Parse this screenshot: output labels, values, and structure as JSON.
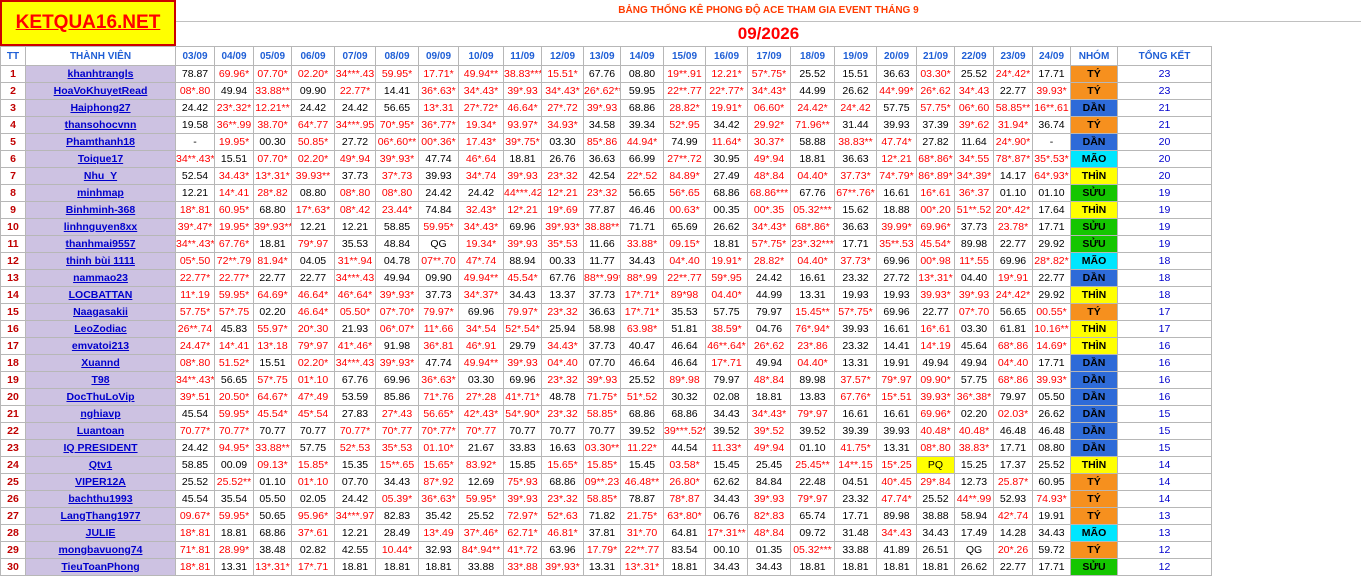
{
  "header": {
    "logo": "KETQUA16.NET",
    "title": "BẢNG THỐNG KÊ PHONG ĐỘ ACE THAM GIA EVENT THÁNG 9",
    "month": "09/2026"
  },
  "columns": {
    "tt": "TT",
    "member": "THÀNH VIÊN",
    "dates": [
      "03/09",
      "04/09",
      "05/09",
      "06/09",
      "07/09",
      "08/09",
      "09/09",
      "10/09",
      "11/09",
      "12/09",
      "13/09",
      "14/09",
      "15/09",
      "16/09",
      "17/09",
      "18/09",
      "19/09",
      "20/09",
      "21/09",
      "22/09",
      "23/09",
      "24/09"
    ],
    "group": "NHÓM",
    "total": "TỔNG KẾT"
  },
  "colors": {
    "TÝ": "#f6901e",
    "DẦN": "#2e6bd8",
    "MÃO": "#00e6ff",
    "THÌN": "#ffff00",
    "SỬU": "#14c600"
  },
  "rows": [
    {
      "tt": "1",
      "name": "khanhtrangls",
      "vals": [
        "78.87",
        "69.96*",
        "07.70*",
        "02.20*",
        "34***.43",
        "59.95*",
        "17.71*",
        "49.94**",
        "38.83***",
        "15.51*",
        "67.76",
        "08.80",
        "19**.91",
        "12.21*",
        "57*.75*",
        "25.52",
        "15.51",
        "36.63",
        "03.30*",
        "25.52",
        "24*.42*",
        "17.71"
      ],
      "group": "TÝ",
      "total": "23"
    },
    {
      "tt": "2",
      "name": "HoaVoKhuyetRead",
      "vals": [
        "08*.80",
        "49.94",
        "33.88**",
        "09.90",
        "22.77*",
        "14.41",
        "36*.63*",
        "34*.43*",
        "39*.93",
        "34*.43*",
        "26*.62**",
        "59.95",
        "22**.77",
        "22*.77*",
        "34*.43*",
        "44.99",
        "26.62",
        "44*.99*",
        "26*.62",
        "34*.43",
        "22.77",
        "39.93*"
      ],
      "group": "TÝ",
      "total": "23"
    },
    {
      "tt": "3",
      "name": "Haiphong27",
      "vals": [
        "24.42",
        "23*.32*",
        "12.21**",
        "24.42",
        "24.42",
        "56.65",
        "13*.31",
        "27*.72*",
        "46.64*",
        "27*.72",
        "39*.93",
        "68.86",
        "28.82*",
        "19.91*",
        "06.60*",
        "24.42*",
        "24*.42",
        "57.75",
        "57.75*",
        "06*.60",
        "58.85**",
        "16**.61"
      ],
      "group": "DẦN",
      "total": "21"
    },
    {
      "tt": "4",
      "name": "thansohocvnn",
      "vals": [
        "19.58",
        "36**.99",
        "38.70*",
        "64*.77",
        "34***.95",
        "70*.95*",
        "36*.77*",
        "19.34*",
        "93.97*",
        "34.93*",
        "34.58",
        "39.34",
        "52*.95",
        "34.42",
        "29.92*",
        "71.96**",
        "31.44",
        "39.93",
        "37.39",
        "39*.62",
        "31.94*",
        "36.74"
      ],
      "group": "TÝ",
      "total": "21"
    },
    {
      "tt": "5",
      "name": "Phamthanh18",
      "vals": [
        "-",
        "19.95*",
        "00.30",
        "50.85*",
        "27.72",
        "06*.60**",
        "00*.36*",
        "17.43*",
        "39*.75*",
        "03.30",
        "85*.86",
        "44.94*",
        "74.99",
        "11.64*",
        "30.37*",
        "58.88",
        "38.83**",
        "47.74*",
        "27.82",
        "11.64",
        "24*.90*",
        "-"
      ],
      "group": "DẦN",
      "total": "20"
    },
    {
      "tt": "6",
      "name": "Toique17",
      "vals": [
        "34**.43*",
        "15.51",
        "07.70*",
        "02.20*",
        "49*.94",
        "39*.93*",
        "47.74",
        "46*.64",
        "18.81",
        "26.76",
        "36.63",
        "66.99",
        "27**.72",
        "30.95",
        "49*.94",
        "18.81",
        "36.63",
        "12*.21",
        "68*.86*",
        "34*.55",
        "78*.87*",
        "35*.53*"
      ],
      "group": "MÃO",
      "total": "20"
    },
    {
      "tt": "7",
      "name": "Nhu_Y",
      "vals": [
        "52.54",
        "34.43*",
        "13*.31*",
        "39.93**",
        "37.73",
        "37*.73",
        "39.93",
        "34*.74",
        "39*.93",
        "23*.32",
        "42.54",
        "22*.52",
        "84.89*",
        "27.49",
        "48*.84",
        "04.40*",
        "37.73*",
        "74*.79*",
        "86*.89*",
        "34*.39*",
        "14.17",
        "64*.93*"
      ],
      "group": "THÌN",
      "total": "20"
    },
    {
      "tt": "8",
      "name": "minhmap",
      "vals": [
        "12.21",
        "14*.41",
        "28*.82",
        "08.80",
        "08*.80",
        "08*.80",
        "24.42",
        "24.42",
        "44***.42*",
        "12*.21",
        "23*.32",
        "56.65",
        "56*.65",
        "68.86",
        "68.86***",
        "67.76",
        "67**.76*",
        "16.61",
        "16*.61",
        "36*.37",
        "01.10",
        "01.10"
      ],
      "group": "SỬU",
      "total": "19"
    },
    {
      "tt": "9",
      "name": "Binhminh-368",
      "vals": [
        "18*.81",
        "60.95*",
        "68.80",
        "17*.63*",
        "08*.42",
        "23.44*",
        "74.84",
        "32.43*",
        "12*.21",
        "19*.69",
        "77.87",
        "46.46",
        "00.63*",
        "00.35",
        "00*.35",
        "05.32***",
        "15.62",
        "18.88",
        "00*.20",
        "51**.52",
        "20*.42*",
        "17.64"
      ],
      "group": "THÌN",
      "total": "19"
    },
    {
      "tt": "10",
      "name": "linhnguyen8xx",
      "vals": [
        "39*.47*",
        "19.95*",
        "39*.93**",
        "12.21",
        "12.21",
        "58.85",
        "59.95*",
        "34*.43*",
        "69.96",
        "39*.93*",
        "38.88**",
        "71.71",
        "65.69",
        "26.62",
        "34*.43*",
        "68*.86*",
        "36.63",
        "39.99*",
        "69.96*",
        "37.73",
        "23.78*",
        "17.71"
      ],
      "group": "SỬU",
      "total": "19"
    },
    {
      "tt": "11",
      "name": "thanhmai9557",
      "vals": [
        "34**.43*",
        "67.76*",
        "18.81",
        "79*.97",
        "35.53",
        "48.84",
        "QG",
        "19.34*",
        "39*.93",
        "35*.53",
        "11.66",
        "33.88*",
        "09.15*",
        "18.81",
        "57*.75*",
        "23*.32***",
        "17.71",
        "35**.53",
        "45.54*",
        "89.98",
        "22.77",
        "29.92"
      ],
      "group": "SỬU",
      "total": "19"
    },
    {
      "tt": "12",
      "name": "thinh bùi 1111",
      "vals": [
        "05*.50",
        "72**.79",
        "81.94*",
        "04.05",
        "31**.94",
        "04.78",
        "07**.70",
        "47*.74",
        "88.94",
        "00.33",
        "11.77",
        "34.43",
        "04*.40",
        "19.91*",
        "28.82*",
        "04.40*",
        "37.73*",
        "69.96",
        "00*.98",
        "11*.55",
        "69.96",
        "28*.82*"
      ],
      "group": "MÃO",
      "total": "18"
    },
    {
      "tt": "13",
      "name": "nammao23",
      "vals": [
        "22.77*",
        "22.77*",
        "22.77",
        "22.77",
        "34***.43",
        "49.94",
        "09.90",
        "49.94**",
        "45.54*",
        "67.76",
        "88**.99*",
        "88*.99",
        "22**.77",
        "59*.95",
        "24.42",
        "16.61",
        "23.32",
        "27.72",
        "13*.31*",
        "04.40",
        "19*.91",
        "22.77"
      ],
      "group": "DẦN",
      "total": "18"
    },
    {
      "tt": "14",
      "name": "LOCBATTAN",
      "vals": [
        "11*.19",
        "59.95*",
        "64.69*",
        "46.64*",
        "46*.64*",
        "39*.93*",
        "37.73",
        "34*.37*",
        "34.43",
        "13.37",
        "37.73",
        "17*.71*",
        "89*98",
        "04.40*",
        "44.99",
        "13.31",
        "19.93",
        "19.93",
        "39.93*",
        "39*.93",
        "24*.42*",
        "29.92"
      ],
      "group": "THÌN",
      "total": "18"
    },
    {
      "tt": "15",
      "name": "Naagasakii",
      "vals": [
        "57.75*",
        "57*.75",
        "02.20",
        "46.64*",
        "05.50*",
        "07*.70*",
        "79.97*",
        "69.96",
        "79.97*",
        "23*.32",
        "36.63",
        "17*.71*",
        "35.53",
        "57.75",
        "79.97",
        "15.45**",
        "57*.75*",
        "69.96",
        "22.77",
        "07*.70",
        "56.65",
        "00.55*"
      ],
      "group": "TÝ",
      "total": "17"
    },
    {
      "tt": "16",
      "name": "LeoZodiac",
      "vals": [
        "26**.74",
        "45.83",
        "55.97*",
        "20*.30",
        "21.93",
        "06*.07*",
        "11*.66",
        "34*.54",
        "52*.54*",
        "25.94",
        "58.98",
        "63.98*",
        "51.81",
        "38.59*",
        "04.76",
        "76*.94*",
        "39.93",
        "16.61",
        "16*.61",
        "03.30",
        "61.81",
        "10.16**"
      ],
      "group": "THÌN",
      "total": "17"
    },
    {
      "tt": "17",
      "name": "emvatoi213",
      "vals": [
        "24.47*",
        "14*.41",
        "13*.18",
        "79*.97",
        "41*.46*",
        "91.98",
        "36*.81",
        "46*.91",
        "29.79",
        "34.43*",
        "37.73",
        "40.47",
        "46.64",
        "46**.64*",
        "26*.62",
        "23*.86",
        "23.32",
        "14.41",
        "14*.19",
        "45.64",
        "68*.86",
        "14.69*"
      ],
      "group": "THÌN",
      "total": "16"
    },
    {
      "tt": "18",
      "name": "Xuannd",
      "vals": [
        "08*.80",
        "51.52*",
        "15.51",
        "02.20*",
        "34***.43",
        "39*.93*",
        "47.74",
        "49.94**",
        "39*.93",
        "04*.40",
        "07.70",
        "46.64",
        "46.64",
        "17*.71",
        "49.94",
        "04.40*",
        "13.31",
        "19.91",
        "49.94",
        "49.94",
        "04*.40",
        "17.71"
      ],
      "group": "DẦN",
      "total": "16"
    },
    {
      "tt": "19",
      "name": "T98",
      "vals": [
        "34**.43*",
        "56.65",
        "57*.75",
        "01*.10",
        "67.76",
        "69.96",
        "36*.63*",
        "03.30",
        "69.96",
        "23*.32",
        "39*.93",
        "25.52",
        "89*.98",
        "79.97",
        "48*.84",
        "89.98",
        "37.57*",
        "79*.97",
        "09.90*",
        "57.75",
        "68*.86",
        "39.93*"
      ],
      "group": "DẦN",
      "total": "16"
    },
    {
      "tt": "20",
      "name": "DocThuLoVip",
      "vals": [
        "39*.51",
        "20.50*",
        "64.67*",
        "47*.49",
        "53.59",
        "85.86",
        "71*.76",
        "27*.28",
        "41*.71*",
        "48.78",
        "71.75*",
        "51*.52",
        "30.32",
        "02.08",
        "18.81",
        "13.83",
        "67.76*",
        "15*.51",
        "39.93*",
        "36*.38*",
        "79.97",
        "05.50"
      ],
      "group": "DẦN",
      "total": "16"
    },
    {
      "tt": "21",
      "name": "nghiavp",
      "vals": [
        "45.54",
        "59.95*",
        "45.54*",
        "45*.54",
        "27.83",
        "27*.43",
        "56.65*",
        "42*.43*",
        "54*.90*",
        "23*.32",
        "58.85*",
        "68.86",
        "68.86",
        "34.43",
        "34*.43*",
        "79*.97",
        "16.61",
        "16.61",
        "69.96*",
        "02.20",
        "02.03*",
        "26.62"
      ],
      "group": "DẦN",
      "total": "15"
    },
    {
      "tt": "22",
      "name": "Luantoan",
      "vals": [
        "70.77*",
        "70.77*",
        "70.77",
        "70.77",
        "70.77*",
        "70*.77",
        "70*.77*",
        "70*.77",
        "70.77",
        "70.77",
        "70.77",
        "39.52",
        "39***.52*",
        "39.52",
        "39*.52",
        "39.52",
        "39.39",
        "39.93",
        "40.48*",
        "40.48*",
        "46.48",
        "46.48"
      ],
      "group": "DẦN",
      "total": "15"
    },
    {
      "tt": "23",
      "name": "IQ PRESIDENT",
      "vals": [
        "24.42",
        "94.95*",
        "33.88**",
        "57.75",
        "52*.53",
        "35*.53",
        "01.10*",
        "21.67",
        "33.83",
        "16.63",
        "03.30**",
        "11.22*",
        "44.54",
        "11.33*",
        "49*.94",
        "01.10",
        "41.75*",
        "13.31",
        "08*.80",
        "38.83*",
        "17.71",
        "08.80"
      ],
      "group": "DẦN",
      "total": "15"
    },
    {
      "tt": "24",
      "name": "Qtv1",
      "vals": [
        "58.85",
        "00.09",
        "09.13*",
        "15.85*",
        "15.35",
        "15**.65",
        "15.65*",
        "83.92*",
        "15.85",
        "15.65*",
        "15.85*",
        "15.45",
        "03.58*",
        "15.45",
        "25.45",
        "25.45**",
        "14**.15",
        "15*.25",
        "PQ",
        "15.25",
        "17.37",
        "25.52"
      ],
      "group": "THÌN",
      "total": "14"
    },
    {
      "tt": "25",
      "name": "VIPER12A",
      "vals": [
        "25.52",
        "25.52**",
        "01.10",
        "01*.10",
        "07.70",
        "34.43",
        "87*.92",
        "12.69",
        "75*.93",
        "68.86",
        "09**.23",
        "46.48**",
        "26.80*",
        "62.62",
        "84.84",
        "22.48",
        "04.51",
        "40*.45",
        "29*.84",
        "12.73",
        "25.87*",
        "60.95"
      ],
      "group": "TÝ",
      "total": "14"
    },
    {
      "tt": "26",
      "name": "bachthu1993",
      "vals": [
        "45.54",
        "35.54",
        "05.50",
        "02.05",
        "24.42",
        "05.39*",
        "36*.63*",
        "59.95*",
        "39*.93",
        "23*.32",
        "58.85*",
        "78.87",
        "78*.87",
        "34.43",
        "39*.93",
        "79*.97",
        "23.32",
        "47.74*",
        "25.52",
        "44**.99",
        "52.93",
        "74.93*"
      ],
      "group": "TÝ",
      "total": "14"
    },
    {
      "tt": "27",
      "name": "LangThang1977",
      "vals": [
        "09.67*",
        "59.95*",
        "50.65",
        "95.96*",
        "34***.97",
        "82.83",
        "35.42",
        "25.52",
        "72.97*",
        "52*.63",
        "71.82",
        "21.75*",
        "63*.80*",
        "06.76",
        "82*.83",
        "65.74",
        "17.71",
        "89.98",
        "38.88",
        "58.94",
        "42*.74",
        "19.91"
      ],
      "group": "TÝ",
      "total": "13"
    },
    {
      "tt": "28",
      "name": "JULIE",
      "vals": [
        "18*.81",
        "18.81",
        "68.86",
        "37*.61",
        "12.21",
        "28.49",
        "13*.49",
        "37*.46*",
        "62.71*",
        "46.81*",
        "37.81",
        "31*.70",
        "64.81",
        "17*.31**",
        "48*.84",
        "09.72",
        "31.48",
        "34*.43",
        "34.43",
        "17.49",
        "14.28",
        "34.43"
      ],
      "group": "MÃO",
      "total": "13"
    },
    {
      "tt": "29",
      "name": "mongbavuong74",
      "vals": [
        "71*.81",
        "28.99*",
        "38.48",
        "02.82",
        "42.55",
        "10.44*",
        "32.93",
        "84*.94**",
        "41*.72",
        "63.96",
        "17.79*",
        "22**.77",
        "83.54",
        "00.10",
        "01.35",
        "05.32***",
        "33.88",
        "41.89",
        "26.51",
        "QG",
        "20*.26",
        "59.72"
      ],
      "group": "TÝ",
      "total": "12"
    },
    {
      "tt": "30",
      "name": "TieuToanPhong",
      "vals": [
        "18*.81",
        "13.31",
        "13*.31*",
        "17*.71",
        "18.81",
        "18.81",
        "18.81",
        "33.88",
        "33*.88",
        "39*.93*",
        "13.31",
        "13*.31*",
        "18.81",
        "34.43",
        "34.43",
        "18.81",
        "18.81",
        "18.81",
        "18.81",
        "26.62",
        "22.77",
        "17.71"
      ],
      "group": "SỬU",
      "total": "12"
    }
  ]
}
